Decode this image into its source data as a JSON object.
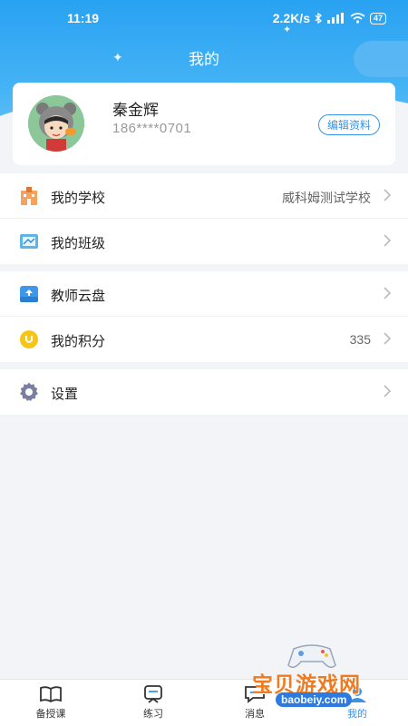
{
  "status_bar": {
    "time": "11:19",
    "speed": "2.2K/s",
    "battery": "47"
  },
  "header": {
    "title": "我的"
  },
  "profile": {
    "name": "秦金辉",
    "phone": "186****0701",
    "edit_label": "编辑资料"
  },
  "menu_groups": [
    {
      "items": [
        {
          "label": "我的学校",
          "value": "威科姆测试学校",
          "icon": "school-icon"
        },
        {
          "label": "我的班级",
          "value": "",
          "icon": "class-icon"
        }
      ]
    },
    {
      "items": [
        {
          "label": "教师云盘",
          "value": "",
          "icon": "cloud-disk-icon"
        },
        {
          "label": "我的积分",
          "value": "335",
          "icon": "points-icon"
        }
      ]
    },
    {
      "items": [
        {
          "label": "设置",
          "value": "",
          "icon": "gear-icon"
        }
      ]
    }
  ],
  "tabs": [
    {
      "label": "备授课",
      "icon": "book-icon",
      "active": false
    },
    {
      "label": "练习",
      "icon": "practice-icon",
      "active": false
    },
    {
      "label": "消息",
      "icon": "message-icon",
      "active": false
    },
    {
      "label": "我的",
      "icon": "profile-icon",
      "active": true
    }
  ],
  "watermark": {
    "text": "宝贝游戏网",
    "url": "baobeiy.com"
  },
  "colors": {
    "primary": "#3a94e6",
    "header_gradient_top": "#29a2f2",
    "background": "#f3f4f8"
  }
}
